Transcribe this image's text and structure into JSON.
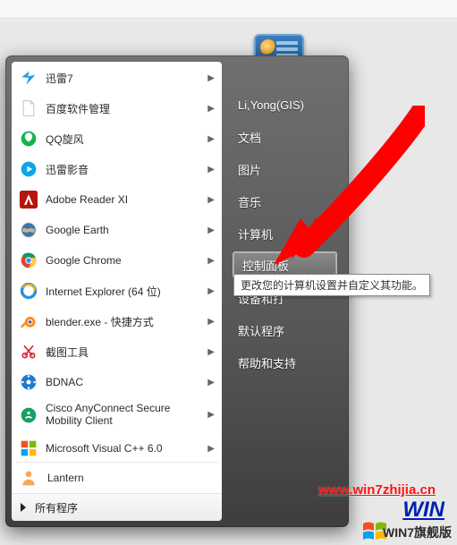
{
  "user_label": "Li,Yong(GIS)",
  "programs": [
    {
      "label": "迅雷7",
      "icon": "xunlei-bird-icon",
      "color": "#1aa0e8"
    },
    {
      "label": "百度软件管理",
      "icon": "page-icon",
      "color": "#ffffff",
      "stroke": "#b8b8b8"
    },
    {
      "label": "QQ旋风",
      "icon": "qq-icon",
      "color": "#17b24a"
    },
    {
      "label": "迅雷影音",
      "icon": "play-icon",
      "color": "#0aa6e6"
    },
    {
      "label": "Adobe Reader XI",
      "icon": "adobe-icon",
      "color": "#b5150d"
    },
    {
      "label": "Google Earth",
      "icon": "earth-icon",
      "color": "#2c6fa3"
    },
    {
      "label": "Google Chrome",
      "icon": "chrome-icon",
      "color": "#ffffff"
    },
    {
      "label": "Internet Explorer (64 位)",
      "icon": "ie-icon",
      "color": "#2a8fe0"
    },
    {
      "label": "blender.exe - 快捷方式",
      "icon": "blender-icon",
      "color": "#ff8a1e"
    },
    {
      "label": "截图工具",
      "icon": "snip-icon",
      "color": "#d8263a"
    },
    {
      "label": "BDNAC",
      "icon": "network-icon",
      "color": "#1e7bd0"
    },
    {
      "label": "Cisco AnyConnect Secure Mobility Client",
      "icon": "cisco-icon",
      "color": "#1aa064",
      "multi": true
    },
    {
      "label": "Microsoft Visual C++ 6.0",
      "icon": "msvc-icon",
      "color": "#444"
    }
  ],
  "pinned_person": {
    "label": "Lantern",
    "icon": "person-icon",
    "color": "#f3a85a"
  },
  "all_programs_label": "所有程序",
  "right_items": [
    {
      "label": "文档"
    },
    {
      "label": "图片"
    },
    {
      "label": "音乐"
    },
    {
      "label": "计算机"
    },
    {
      "label": "控制面板",
      "hovered": true
    },
    {
      "label": "设备和打",
      "truncated": true
    },
    {
      "label": "默认程序"
    },
    {
      "label": "帮助和支持"
    }
  ],
  "tooltip_text": "更改您的计算机设置并自定义其功能。",
  "watermark_url": "www.win7zhijia.cn",
  "watermark_brand": "WIN",
  "watermark_edition": "WIN7旗舰版"
}
